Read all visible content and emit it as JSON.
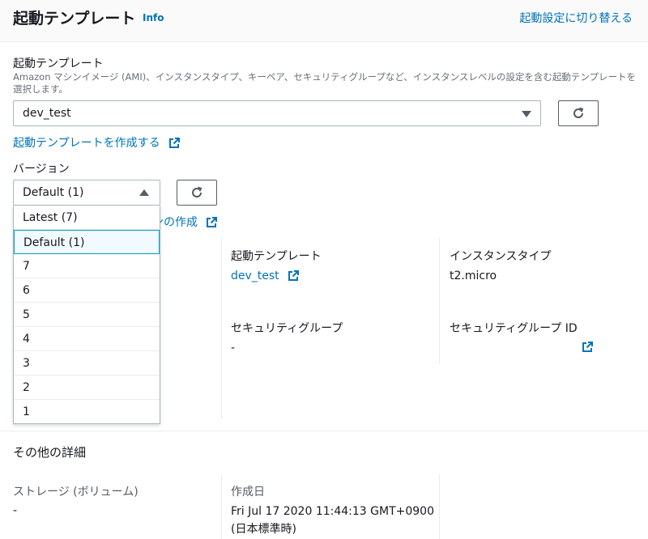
{
  "header": {
    "title": "起動テンプレート",
    "info": "Info",
    "switch_link": "起動設定に切り替える"
  },
  "template_field": {
    "label": "起動テンプレート",
    "description": "Amazon マシンイメージ (AMI)、インスタンスタイプ、キーペア、セキュリティグループなど、インスタンスレベルの設定を含む起動テンプレートを選択します。",
    "selected": "dev_test",
    "create_link": "起動テンプレートを作成する"
  },
  "version_field": {
    "label": "バージョン",
    "selected": "Default (1)",
    "create_link_partial": "ンの作成",
    "options": [
      "Latest (7)",
      "Default (1)",
      "7",
      "6",
      "5",
      "4",
      "3",
      "2",
      "1"
    ]
  },
  "details": {
    "launch_template_label": "起動テンプレート",
    "launch_template_value": "dev_test",
    "instance_type_label": "インスタンスタイプ",
    "instance_type_value": "t2.micro",
    "security_group_label": "セキュリティグループ",
    "security_group_value": "-",
    "security_group_id_label": "セキュリティグループ ID"
  },
  "other_details": {
    "heading": "その他の詳細",
    "storage_label": "ストレージ (ボリューム)",
    "storage_value": "-",
    "created_label": "作成日",
    "created_value_line1": "Fri Jul 17 2020 11:44:13 GMT+0900",
    "created_value_line2": "(日本標準時)"
  },
  "colors": {
    "link": "#0073bb",
    "accent": "#00a1c9"
  }
}
